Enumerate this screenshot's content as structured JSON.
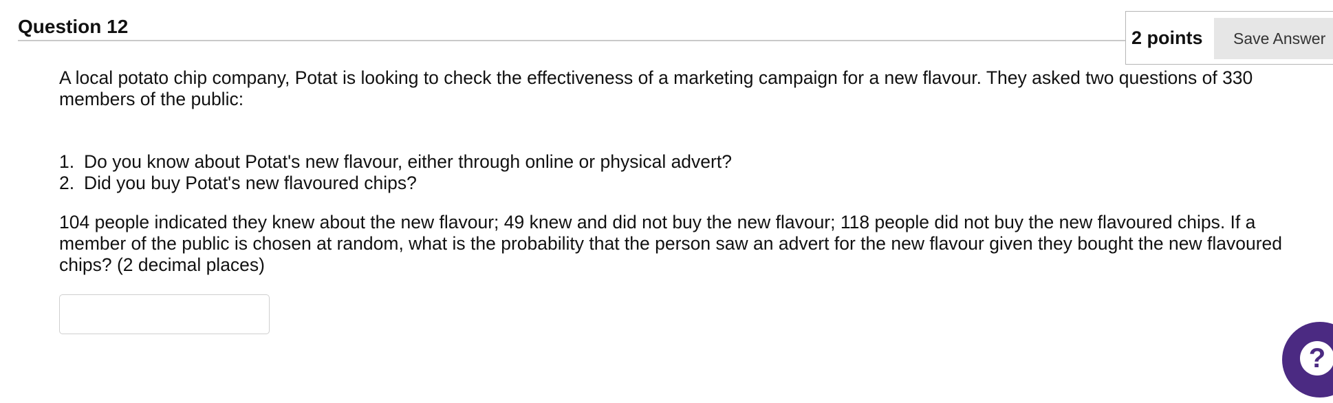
{
  "question": {
    "title": "Question 12",
    "points": "2 points",
    "save_label": "Save Answer"
  },
  "body": {
    "intro": "A local potato chip company, Potat is looking to check the effectiveness of a marketing campaign for a new flavour. They asked two questions of 330 members of the public:",
    "questions": [
      {
        "num": "1.",
        "text": "Do you know about Potat's new flavour, either through online or physical advert?"
      },
      {
        "num": "2.",
        "text": "Did you buy Potat's new flavoured chips?"
      }
    ],
    "details": "104 people indicated they knew about the new flavour; 49 knew and did not buy the new flavour; 118 people did not buy the new flavoured chips. If a member of the public is chosen at random, what is the probability that the person saw an advert for the new flavour given they bought the new flavoured chips? (2 decimal  places)"
  },
  "answer": {
    "value": "",
    "placeholder": ""
  },
  "help": {
    "icon": "question-mark-icon",
    "glyph": "?",
    "color": "#4b2a82"
  }
}
